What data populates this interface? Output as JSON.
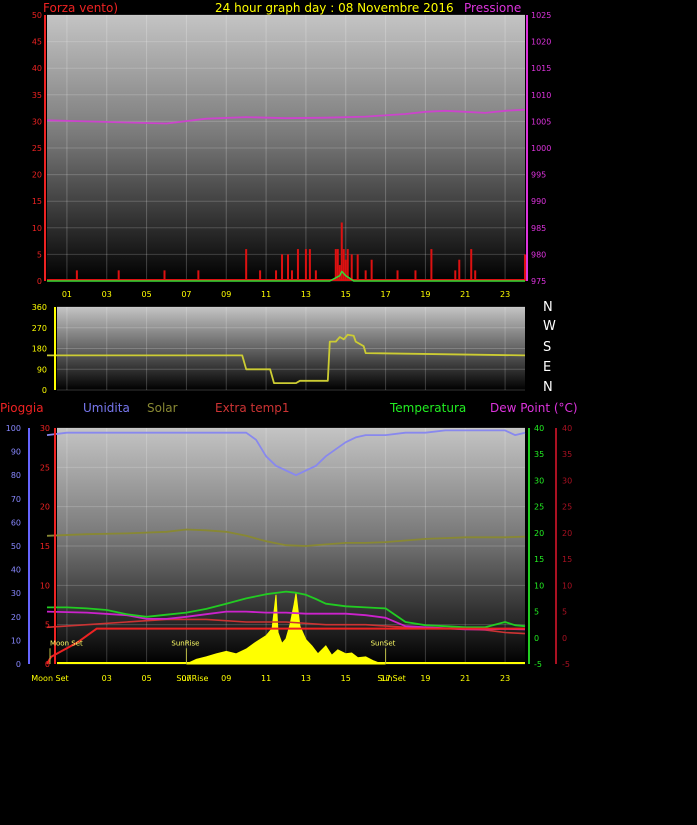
{
  "title": "24 hour graph day : 08 Novembre 2016",
  "colors": {
    "wind": "#dd1111",
    "gust": "#33dd33",
    "pressure": "#cc44cc",
    "direction": "#cccc33",
    "rain": "#ee2222",
    "humidity": "#8888ee",
    "solar": "#888833",
    "extra_temp": "#cc3333",
    "temperature": "#22cc22",
    "dewpoint": "#cc22cc",
    "yellow": "#ffff00",
    "rain_axis": "#6666ff",
    "extra_axis": "#aa1122"
  },
  "hour_labels": [
    "01",
    "03",
    "05",
    "07",
    "09",
    "11",
    "13",
    "15",
    "17",
    "19",
    "21",
    "23"
  ],
  "chart_data": [
    {
      "type": "line",
      "title": "24 hour graph day : 08 Novembre 2016",
      "left_axis_label": "Forza vento)",
      "right_axis_label": "Pressione",
      "xlim": [
        0,
        24
      ],
      "ylim": [
        0,
        50
      ],
      "y2lim": [
        975,
        1025
      ],
      "yticks": [
        0,
        5,
        10,
        15,
        20,
        25,
        30,
        35,
        40,
        45,
        50
      ],
      "y2ticks": [
        975,
        980,
        985,
        990,
        995,
        1000,
        1005,
        1010,
        1015,
        1020,
        1025
      ],
      "grid": true,
      "series": [
        {
          "name": "pressure",
          "axis": "right",
          "x": [
            0,
            2,
            4,
            6,
            8,
            10,
            12,
            14,
            16,
            18,
            19,
            20,
            21,
            22,
            23,
            24
          ],
          "y": [
            1005.2,
            1005.0,
            1004.8,
            1004.6,
            1005.5,
            1005.8,
            1005.6,
            1005.7,
            1005.9,
            1006.4,
            1006.8,
            1007.0,
            1006.8,
            1006.6,
            1007.0,
            1007.2
          ]
        },
        {
          "name": "wind",
          "axis": "left",
          "style": "spikes",
          "x": [
            1.5,
            3.6,
            5.9,
            7.6,
            10.0,
            10.7,
            11.5,
            11.8,
            12.1,
            12.3,
            12.6,
            13.0,
            13.2,
            13.5,
            14.5,
            14.6,
            14.7,
            14.8,
            14.9,
            15.0,
            15.1,
            15.3,
            15.6,
            16.0,
            16.3,
            17.6,
            18.5,
            19.3,
            20.5,
            20.7,
            21.3,
            21.5,
            24.0
          ],
          "y": [
            2,
            2,
            2,
            2,
            6,
            2,
            2,
            5,
            5,
            2,
            6,
            6,
            6,
            2,
            6,
            6,
            3,
            11,
            6,
            4,
            6,
            5,
            5,
            2,
            4,
            2,
            2,
            6,
            2,
            4,
            6,
            2,
            5
          ]
        },
        {
          "name": "gust",
          "axis": "left",
          "x": [
            0,
            14.2,
            14.5,
            14.7,
            14.8,
            15.0,
            15.2,
            15.4,
            24
          ],
          "y": [
            0,
            0,
            0.6,
            1.0,
            1.8,
            1.0,
            0.5,
            0,
            0
          ]
        }
      ]
    },
    {
      "type": "line",
      "xlim": [
        0,
        24
      ],
      "ylim": [
        0,
        360
      ],
      "yticks": [
        0,
        90,
        180,
        270,
        360
      ],
      "compass_labels": [
        "N",
        "W",
        "S",
        "E",
        "N"
      ],
      "grid": true,
      "series": [
        {
          "name": "direction",
          "x": [
            0,
            9.8,
            10,
            11.2,
            11.4,
            12.5,
            12.7,
            14.1,
            14.2,
            14.5,
            14.7,
            14.9,
            15.1,
            15.4,
            15.5,
            15.9,
            16.0,
            24
          ],
          "y": [
            150,
            150,
            90,
            90,
            30,
            30,
            40,
            40,
            210,
            210,
            230,
            220,
            240,
            235,
            210,
            190,
            160,
            150
          ]
        }
      ]
    },
    {
      "type": "line",
      "left_labels": [
        "Pioggia",
        "Umidita",
        "Solar",
        "Extra temp1"
      ],
      "right_labels": [
        "Temperatura",
        "Dew Point (°C)"
      ],
      "xlim": [
        0,
        24
      ],
      "rain_axis": {
        "ylim": [
          0,
          100
        ],
        "ticks": [
          0,
          10,
          20,
          30,
          40,
          50,
          60,
          70,
          80,
          90,
          100
        ]
      },
      "second_axis": {
        "ylim": [
          0,
          30
        ],
        "ticks": [
          0,
          5,
          10,
          15,
          20,
          25,
          30
        ]
      },
      "temp_axis": {
        "ylim": [
          -5,
          40
        ],
        "ticks": [
          -5,
          0,
          5,
          10,
          15,
          20,
          25,
          30,
          35,
          40
        ]
      },
      "extra_axis": {
        "ylim": [
          -5,
          40
        ],
        "ticks": [
          -5,
          0,
          5,
          10,
          15,
          20,
          25,
          30,
          35,
          40
        ]
      },
      "grid": true,
      "markers": [
        {
          "label": "Moon Set",
          "x": 0.15
        },
        {
          "label": "SunRise",
          "x": 7.0
        },
        {
          "label": "SunSet",
          "x": 17.0
        }
      ],
      "series": [
        {
          "name": "humidity",
          "axis": "rain",
          "x": [
            0,
            1,
            3,
            5,
            7,
            8,
            9,
            10,
            10.5,
            11,
            11.5,
            12,
            12.5,
            13,
            13.5,
            14,
            14.5,
            15,
            15.5,
            16,
            17,
            18,
            19,
            20,
            21,
            22,
            23,
            23.5,
            24
          ],
          "y": [
            97,
            98,
            98,
            98,
            98,
            98,
            98,
            98,
            95,
            88,
            84,
            82,
            80,
            82,
            84,
            88,
            91,
            94,
            96,
            97,
            97,
            98,
            98,
            99,
            99,
            99,
            99,
            97,
            98
          ]
        },
        {
          "name": "rain",
          "axis": "rain",
          "x": [
            0,
            0.2,
            1.5,
            2.5,
            24
          ],
          "y": [
            0,
            3,
            9,
            15,
            15
          ]
        },
        {
          "name": "solar",
          "axis": "second",
          "x": [
            0,
            2,
            4,
            6,
            7,
            8,
            9,
            10,
            11,
            12,
            13,
            14,
            15,
            16,
            17,
            18,
            19,
            20,
            21,
            22,
            23,
            24
          ],
          "y": [
            16.3,
            16.5,
            16.6,
            16.8,
            17.1,
            17.0,
            16.8,
            16.3,
            15.6,
            15.1,
            15.0,
            15.2,
            15.4,
            15.4,
            15.5,
            15.7,
            15.9,
            16.0,
            16.1,
            16.1,
            16.1,
            16.2
          ]
        },
        {
          "name": "extra_temp",
          "axis": "extra",
          "x": [
            0,
            2,
            4,
            6,
            8,
            10,
            12,
            14,
            16,
            18,
            20,
            22,
            23,
            24
          ],
          "y": [
            2.0,
            2.5,
            3.0,
            3.5,
            3.5,
            3.0,
            3.0,
            2.5,
            2.5,
            2.0,
            1.8,
            1.5,
            1.0,
            0.8
          ]
        },
        {
          "name": "temperature",
          "axis": "temp",
          "x": [
            0,
            1,
            2,
            3,
            4,
            5,
            6,
            7,
            8,
            9,
            10,
            11,
            12,
            12.5,
            13,
            13.5,
            14,
            15,
            16,
            17,
            18,
            19,
            20,
            21,
            22,
            23,
            23.5,
            24
          ],
          "y": [
            5.8,
            5.8,
            5.6,
            5.3,
            4.5,
            4.0,
            4.4,
            4.8,
            5.5,
            6.5,
            7.5,
            8.3,
            8.8,
            8.6,
            8.2,
            7.4,
            6.5,
            6.0,
            5.8,
            5.6,
            3.0,
            2.4,
            2.2,
            2.0,
            2.0,
            3.0,
            2.4,
            2.2
          ]
        },
        {
          "name": "dewpoint",
          "axis": "temp",
          "x": [
            0,
            2,
            4,
            5,
            6,
            7,
            8,
            9,
            10,
            11,
            12,
            13,
            14,
            15,
            16,
            17,
            18,
            19,
            20,
            21,
            22,
            23,
            24
          ],
          "y": [
            5.0,
            4.8,
            4.3,
            3.6,
            3.6,
            4.0,
            4.5,
            5.0,
            5.0,
            4.8,
            4.8,
            4.6,
            4.6,
            4.6,
            4.3,
            3.8,
            2.2,
            2.0,
            1.8,
            1.6,
            1.6,
            1.7,
            1.6
          ]
        },
        {
          "name": "solar_radiation",
          "axis": "second",
          "style": "filled",
          "x": [
            7.0,
            7.5,
            8,
            8.5,
            9,
            9.5,
            10,
            10.5,
            11,
            11.3,
            11.5,
            11.6,
            11.8,
            12,
            12.2,
            12.4,
            12.5,
            12.7,
            13,
            13.3,
            13.6,
            14,
            14.3,
            14.6,
            15,
            15.3,
            15.6,
            16,
            16.4,
            16.7,
            17
          ],
          "y": [
            0,
            0.6,
            0.9,
            1.3,
            1.6,
            1.3,
            1.9,
            2.8,
            3.6,
            4.5,
            8.8,
            4.0,
            2.6,
            3.2,
            5.0,
            7.5,
            9.0,
            4.8,
            3.1,
            2.3,
            1.3,
            2.3,
            1.1,
            1.8,
            1.3,
            1.4,
            0.8,
            0.9,
            0.4,
            0.1,
            0
          ]
        }
      ]
    }
  ]
}
